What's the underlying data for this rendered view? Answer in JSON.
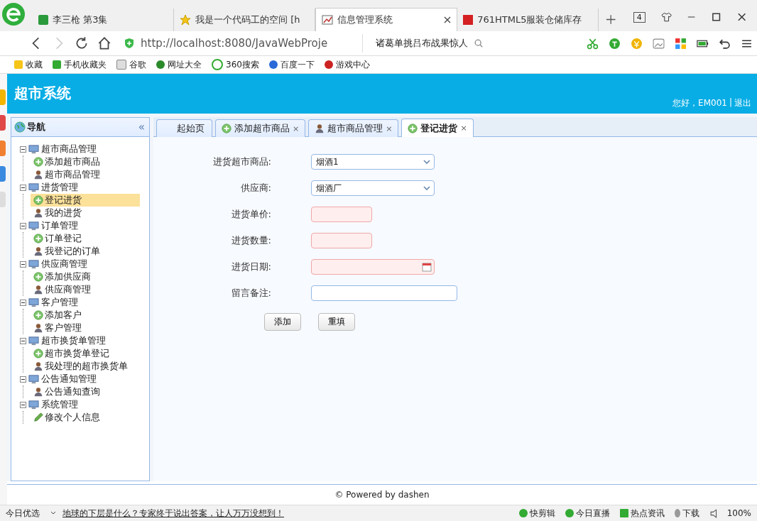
{
  "browser": {
    "tabs": [
      {
        "title": "李三枪 第3集",
        "selected": false
      },
      {
        "title": "我是一个代码工的空间 [h",
        "selected": false
      },
      {
        "title": "信息管理系统",
        "selected": true
      },
      {
        "title": "761HTML5服装仓储库存",
        "selected": false
      }
    ],
    "tab_count": "4",
    "address": {
      "url": "http://localhost:8080/JavaWebProje",
      "search_hint": "诸葛单挑吕布战果惊人"
    },
    "bookmarks": [
      "收藏",
      "手机收藏夹",
      "谷歌",
      "网址大全",
      "360搜索",
      "百度一下",
      "游戏中心"
    ]
  },
  "app": {
    "title": "超市系统",
    "greeting": "您好，EM001",
    "separator": "|",
    "logout": "退出",
    "nav": {
      "title": "导航",
      "collapse": "«",
      "tree": [
        {
          "label": "超市商品管理",
          "expanded": true,
          "children": [
            {
              "label": "添加超市商品",
              "kind": "add",
              "selected": false
            },
            {
              "label": "超市商品管理",
              "kind": "list",
              "selected": false
            }
          ]
        },
        {
          "label": "进货管理",
          "expanded": true,
          "children": [
            {
              "label": "登记进货",
              "kind": "add",
              "selected": true
            },
            {
              "label": "我的进货",
              "kind": "list",
              "selected": false
            }
          ]
        },
        {
          "label": "订单管理",
          "expanded": true,
          "children": [
            {
              "label": "订单登记",
              "kind": "add",
              "selected": false
            },
            {
              "label": "我登记的订单",
              "kind": "list",
              "selected": false
            }
          ]
        },
        {
          "label": "供应商管理",
          "expanded": true,
          "children": [
            {
              "label": "添加供应商",
              "kind": "add",
              "selected": false
            },
            {
              "label": "供应商管理",
              "kind": "list",
              "selected": false
            }
          ]
        },
        {
          "label": "客户管理",
          "expanded": true,
          "children": [
            {
              "label": "添加客户",
              "kind": "add",
              "selected": false
            },
            {
              "label": "客户管理",
              "kind": "list",
              "selected": false
            }
          ]
        },
        {
          "label": "超市换货单管理",
          "expanded": true,
          "children": [
            {
              "label": "超市换货单登记",
              "kind": "add",
              "selected": false
            },
            {
              "label": "我处理的超市换货单",
              "kind": "list",
              "selected": false
            }
          ]
        },
        {
          "label": "公告通知管理",
          "expanded": true,
          "children": [
            {
              "label": "公告通知查询",
              "kind": "list",
              "selected": false
            }
          ]
        },
        {
          "label": "系统管理",
          "expanded": true,
          "children": [
            {
              "label": "修改个人信息",
              "kind": "edit",
              "selected": false
            }
          ]
        }
      ]
    },
    "tabs": [
      {
        "label": "起始页",
        "kind": "home",
        "selected": false
      },
      {
        "label": "添加超市商品",
        "kind": "add",
        "close": "×",
        "selected": false
      },
      {
        "label": "超市商品管理",
        "kind": "list",
        "close": "×",
        "selected": false
      },
      {
        "label": "登记进货",
        "kind": "add",
        "close": "×",
        "selected": true
      }
    ],
    "form": {
      "fields": [
        {
          "label": "进货超市商品:",
          "kind": "select",
          "value": "烟酒1",
          "invalid": false
        },
        {
          "label": "供应商:",
          "kind": "select",
          "value": "烟酒厂",
          "invalid": false
        },
        {
          "label": "进货单价:",
          "kind": "short",
          "invalid": true
        },
        {
          "label": "进货数量:",
          "kind": "short",
          "invalid": true
        },
        {
          "label": "进货日期:",
          "kind": "date",
          "invalid": true
        },
        {
          "label": "留言备注:",
          "kind": "text",
          "invalid": false
        }
      ],
      "buttons": [
        "添加",
        "重填"
      ]
    },
    "footer": "© Powered by dashen"
  },
  "status_bar": {
    "left": "今日优选",
    "news": "地球的下层是什么？专家终于说出答案，让人万万没想到！",
    "items": [
      "快剪辑",
      "今日直播",
      "热点资讯",
      "下载"
    ],
    "zoom": "100%"
  }
}
